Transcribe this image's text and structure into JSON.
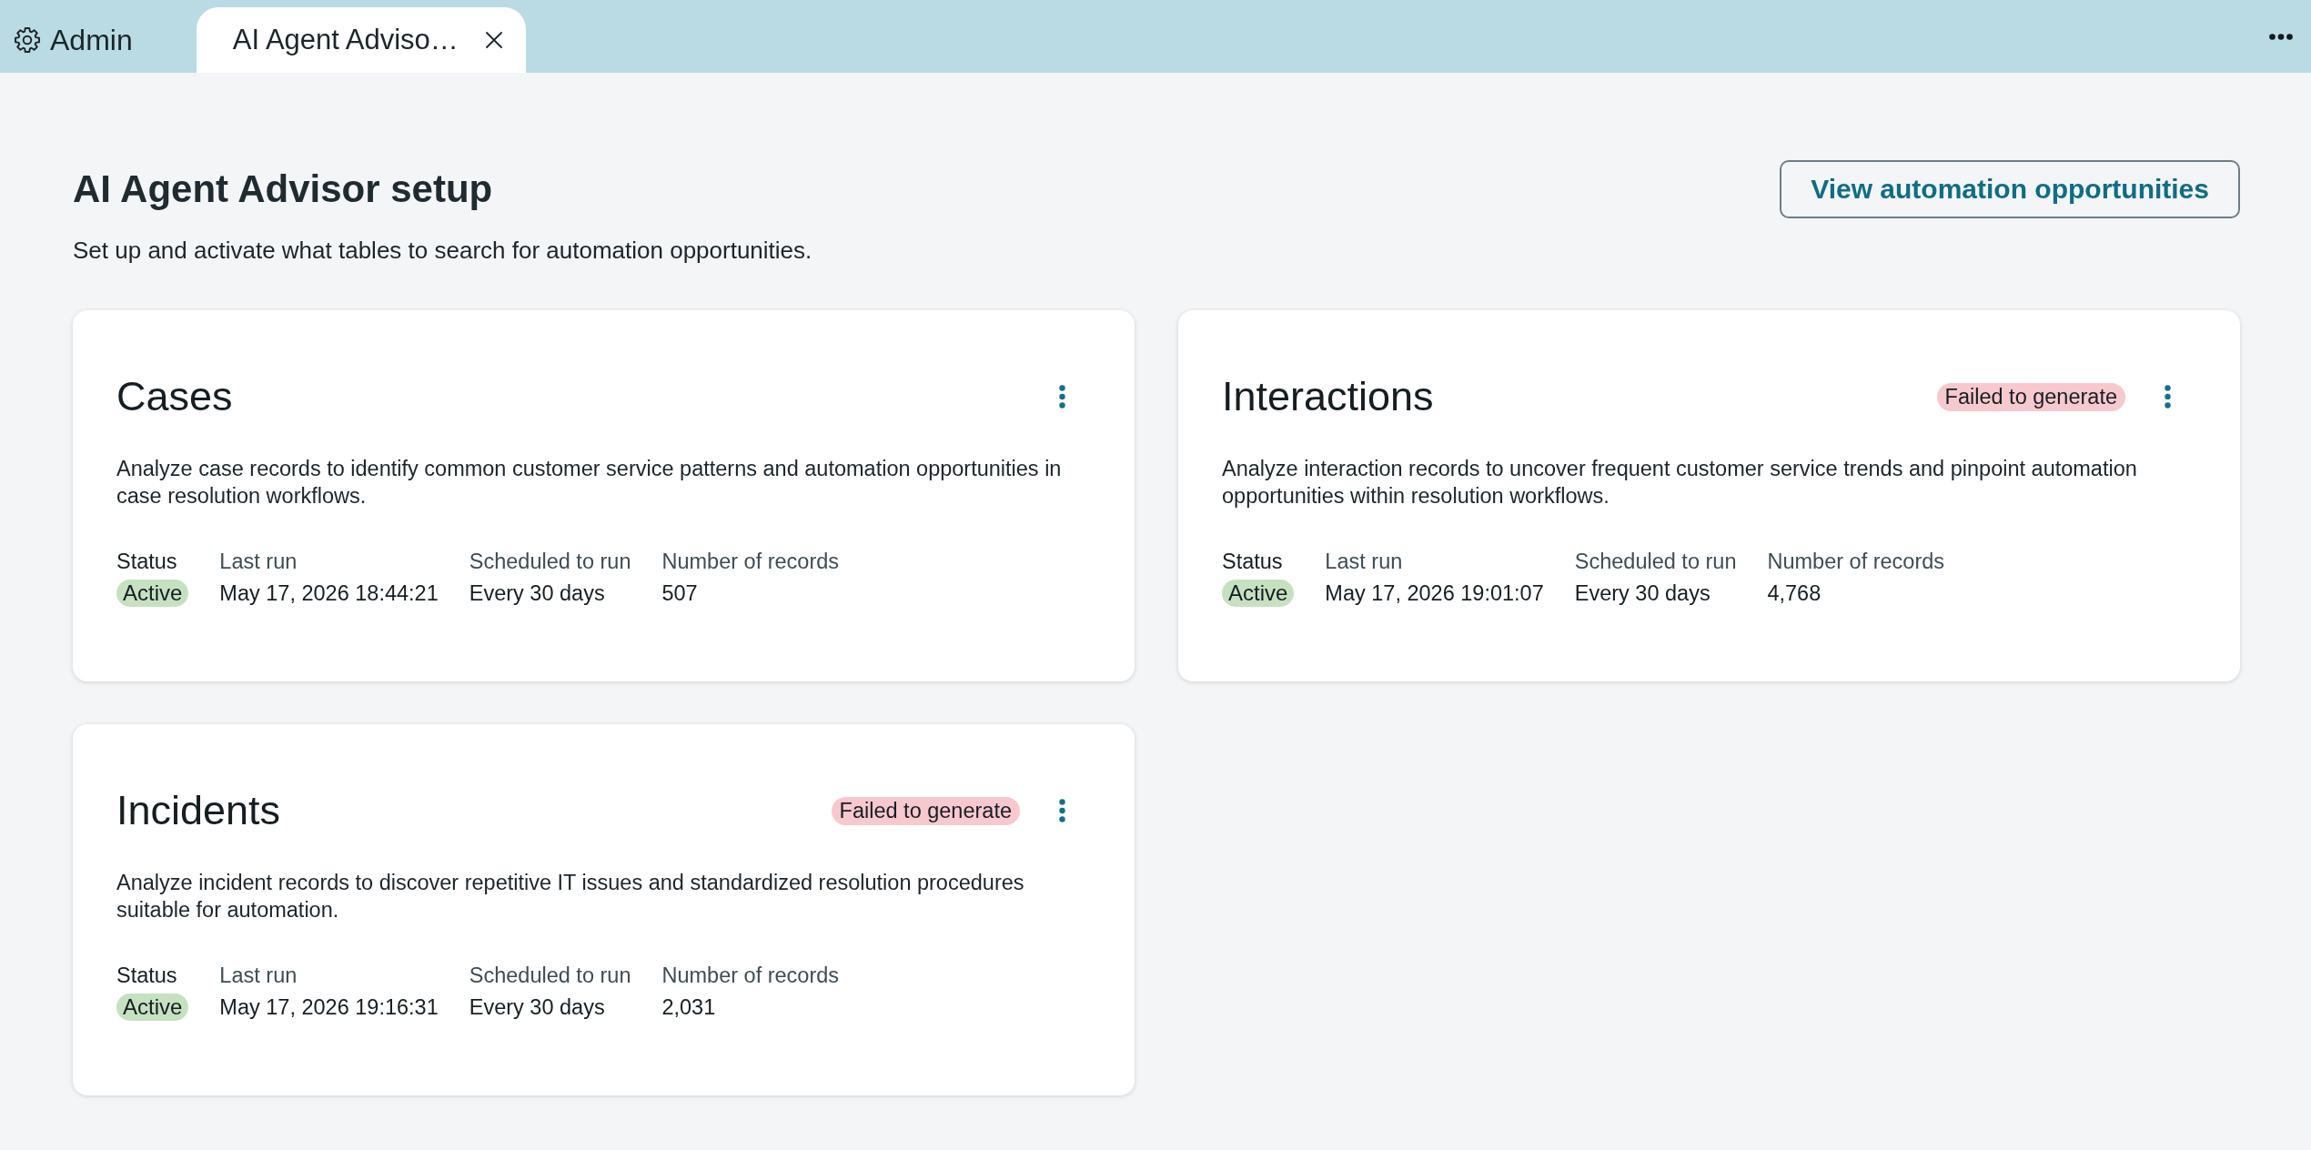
{
  "tabs": [
    {
      "kind": "home",
      "label": "Admin",
      "selected": false
    },
    {
      "kind": "page",
      "label": "AI Agent Adviso…",
      "selected": true
    }
  ],
  "header": {
    "title": "AI Agent Advisor setup",
    "subtitle": "Set up and activate what tables to search for automation opportunities.",
    "action": "View automation opportunities"
  },
  "cards": [
    {
      "title": "Cases",
      "description": "Analyze case records to identify common customer service patterns and automation opportunities in case resolution workflows.",
      "stats": [
        {
          "kind": "badge",
          "label": "Status",
          "value": "Active"
        },
        {
          "kind": "text",
          "label": "Last run",
          "value": "May 17, 2026 18:44:21"
        },
        {
          "kind": "text",
          "label": "Scheduled to run",
          "value": "Every 30 days"
        },
        {
          "kind": "text",
          "label": "Number of records",
          "value": "507"
        }
      ]
    },
    {
      "title": "Interactions",
      "alert": {
        "kind": "error",
        "label": "Failed to generate"
      },
      "description": "Analyze interaction records to uncover frequent customer service trends and pinpoint automation opportunities within resolution workflows.",
      "stats": [
        {
          "kind": "badge",
          "label": "Status",
          "value": "Active"
        },
        {
          "kind": "text",
          "label": "Last run",
          "value": "May 17, 2026 19:01:07"
        },
        {
          "kind": "text",
          "label": "Scheduled to run",
          "value": "Every 30 days"
        },
        {
          "kind": "text",
          "label": "Number of records",
          "value": "4,768"
        }
      ]
    },
    {
      "title": "Incidents",
      "alert": {
        "kind": "error",
        "label": "Failed to generate"
      },
      "description": "Analyze incident records to discover repetitive IT issues and standardized resolution procedures suitable for automation.",
      "stats": [
        {
          "kind": "badge",
          "label": "Status",
          "value": "Active"
        },
        {
          "kind": "text",
          "label": "Last run",
          "value": "May 17, 2026 19:16:31"
        },
        {
          "kind": "text",
          "label": "Scheduled to run",
          "value": "Every 30 days"
        },
        {
          "kind": "text",
          "label": "Number of records",
          "value": "2,031"
        }
      ]
    }
  ]
}
